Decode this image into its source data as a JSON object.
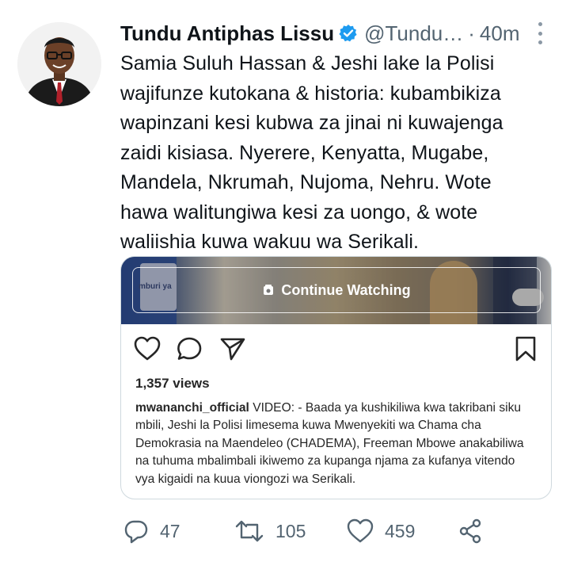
{
  "tweet": {
    "author_name": "Tundu Antiphas Lissu",
    "handle": "@Tundu…",
    "separator": "·",
    "time": "40m",
    "text": "Samia Suluh Hassan & Jeshi lake la Polisi\nwajifunze kutokana & historia: kubambikiza\nwapinzani kesi kubwa za jinai ni kuwajenga\nzaidi kisiasa. Nyerere, Kenyatta, Mugabe,\nMandela, Nkrumah, Nujoma, Nehru. Wote\nhawa walitungiwa kesi za uongo, & wote\nwaliishia kuwa wakuu wa Serikali.",
    "verified_color": "#1d9bf0",
    "icons": [
      "verified-badge-icon",
      "more-options-icon"
    ]
  },
  "embed": {
    "video_button": "Continue Watching",
    "video_sign": "mburi ya",
    "views": "1,357 views",
    "caption_user": "mwananchi_official",
    "caption_text": " VIDEO: - Baada ya kushikiliwa kwa takribani siku mbili, Jeshi la Polisi limesema kuwa Mwenyekiti wa Chama cha Demokrasia na Maendeleo (CHADEMA), Freeman Mbowe anakabiliwa na tuhuma mbalimbali ikiwemo za kupanga njama za kufanya vitendo vya kigaidi na kuua viongozi wa Serikali.",
    "icons": [
      "heart-icon",
      "comment-icon",
      "share-paper-plane-icon",
      "bookmark-icon"
    ]
  },
  "stats": {
    "replies": "47",
    "retweets": "105",
    "likes": "459",
    "icons": [
      "reply-icon",
      "retweet-icon",
      "like-icon",
      "share-icon"
    ]
  }
}
